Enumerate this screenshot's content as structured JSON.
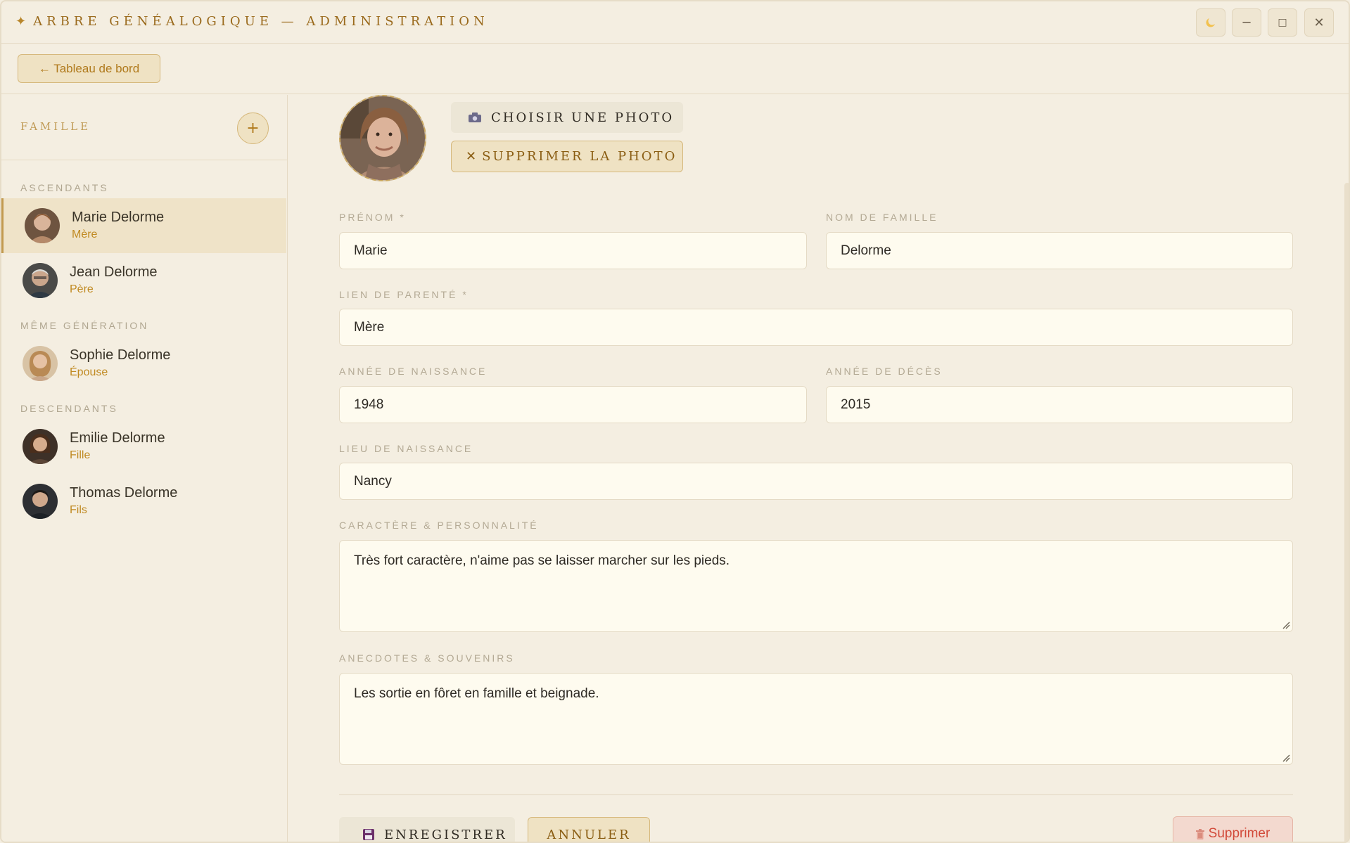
{
  "window": {
    "title": "ARBRE GÉNÉALOGIQUE — ADMINISTRATION",
    "title_icon": "✦",
    "controls": {
      "theme_icon": "moon-icon",
      "minimize": "─",
      "maximize": "□",
      "close": "✕"
    }
  },
  "toolbar": {
    "back_label": "← Tableau de bord"
  },
  "sidebar": {
    "title": "FAMILLE",
    "add_label": "+",
    "groups": [
      {
        "label": "ASCENDANTS",
        "members": [
          {
            "name": "Marie Delorme",
            "role": "Mère",
            "active": true
          },
          {
            "name": "Jean Delorme",
            "role": "Père",
            "active": false
          }
        ]
      },
      {
        "label": "MÊME GÉNÉRATION",
        "members": [
          {
            "name": "Sophie Delorme",
            "role": "Épouse",
            "active": false
          }
        ]
      },
      {
        "label": "DESCENDANTS",
        "members": [
          {
            "name": "Emilie Delorme",
            "role": "Fille",
            "active": false
          },
          {
            "name": "Thomas Delorme",
            "role": "Fils",
            "active": false
          }
        ]
      }
    ]
  },
  "form": {
    "photo": {
      "choose_label": "CHOISIR UNE PHOTO",
      "choose_icon": "camera-icon",
      "remove_label": "SUPPRIMER LA PHOTO",
      "remove_icon": "✕"
    },
    "prenom": {
      "label": "PRÉNOM *",
      "value": "Marie"
    },
    "nom": {
      "label": "NOM DE FAMILLE",
      "value": "Delorme"
    },
    "lien": {
      "label": "LIEN DE PARENTÉ *",
      "value": "Mère"
    },
    "naissance": {
      "label": "ANNÉE DE NAISSANCE",
      "value": "1948"
    },
    "deces": {
      "label": "ANNÉE DE DÉCÈS",
      "value": "2015"
    },
    "lieu": {
      "label": "LIEU DE NAISSANCE",
      "value": "Nancy"
    },
    "caractere": {
      "label": "CARACTÈRE & PERSONNALITÉ",
      "value": "Très fort caractère, n'aime pas se laisser marcher sur les pieds."
    },
    "anecdotes": {
      "label": "ANECDOTES & SOUVENIRS",
      "value": "Les sortie en fôret en famille et beignade."
    }
  },
  "actions": {
    "save_label": "ENREGISTRER",
    "save_icon": "floppy-disk-icon",
    "cancel_label": "ANNULER",
    "delete_label": "Supprimer",
    "delete_icon": "trash-icon"
  },
  "colors": {
    "background": "#f4eee1",
    "accent": "#c08a22",
    "field_bg": "#fefbef",
    "danger": "#d24a3a"
  }
}
